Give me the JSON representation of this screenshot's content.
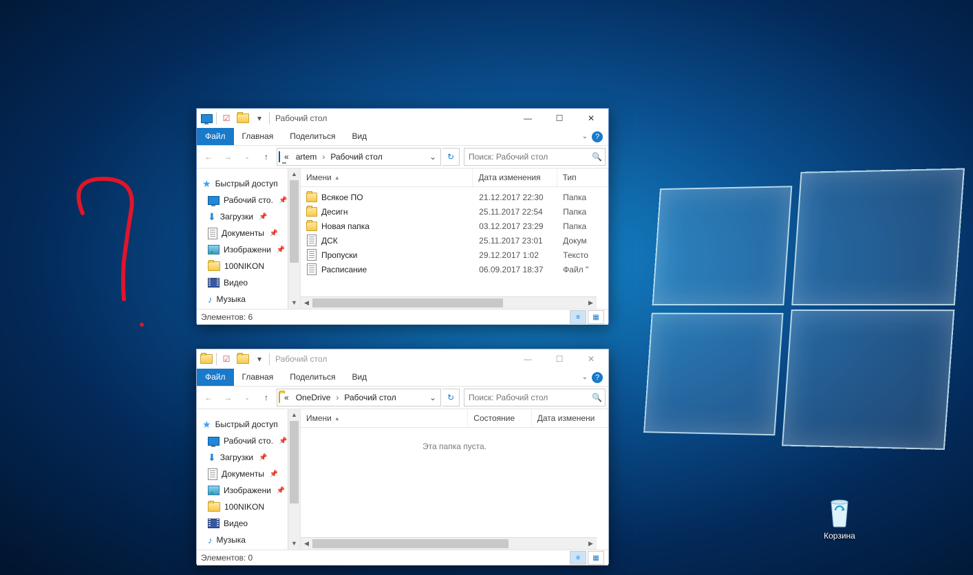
{
  "desktop": {
    "recycle_label": "Корзина"
  },
  "w1": {
    "title": "Рабочий стол",
    "ribbon": {
      "file": "Файл",
      "home": "Главная",
      "share": "Поделиться",
      "view": "Вид"
    },
    "breadcrumb": {
      "root": "«",
      "seg1": "artem",
      "seg2": "Рабочий стол"
    },
    "search_placeholder": "Поиск: Рабочий стол",
    "nav": {
      "quick": "Быстрый доступ",
      "desktop": "Рабочий сто.",
      "downloads": "Загрузки",
      "documents": "Документы",
      "pictures": "Изображени",
      "nikon": "100NIKON",
      "video": "Видео",
      "music": "Музыка"
    },
    "cols": {
      "name": "Имени",
      "date": "Дата изменения",
      "type": "Тип"
    },
    "files": [
      {
        "icon": "folder",
        "name": "Всякое ПО",
        "date": "21.12.2017 22:30",
        "type": "Папка"
      },
      {
        "icon": "folder",
        "name": "Десигн",
        "date": "25.11.2017 22:54",
        "type": "Папка"
      },
      {
        "icon": "folder",
        "name": "Новая папка",
        "date": "03.12.2017 23:29",
        "type": "Папка"
      },
      {
        "icon": "doc",
        "name": "ДСК",
        "date": "25.11.2017 23:01",
        "type": "Докум"
      },
      {
        "icon": "doc",
        "name": "Пропуски",
        "date": "29.12.2017 1:02",
        "type": "Тексто"
      },
      {
        "icon": "doc",
        "name": "Расписание",
        "date": "06.09.2017 18:37",
        "type": "Файл \""
      }
    ],
    "status": "Элементов: 6"
  },
  "w2": {
    "title": "Рабочий стол",
    "ribbon": {
      "file": "Файл",
      "home": "Главная",
      "share": "Поделиться",
      "view": "Вид"
    },
    "breadcrumb": {
      "root": "«",
      "seg1": "OneDrive",
      "seg2": "Рабочий стол"
    },
    "search_placeholder": "Поиск: Рабочий стол",
    "nav": {
      "quick": "Быстрый доступ",
      "desktop": "Рабочий сто.",
      "downloads": "Загрузки",
      "documents": "Документы",
      "pictures": "Изображени",
      "nikon": "100NIKON",
      "video": "Видео",
      "music": "Музыка"
    },
    "cols": {
      "name": "Имени",
      "state": "Состояние",
      "date": "Дата изменени"
    },
    "empty": "Эта папка пуста.",
    "status": "Элементов: 0"
  }
}
